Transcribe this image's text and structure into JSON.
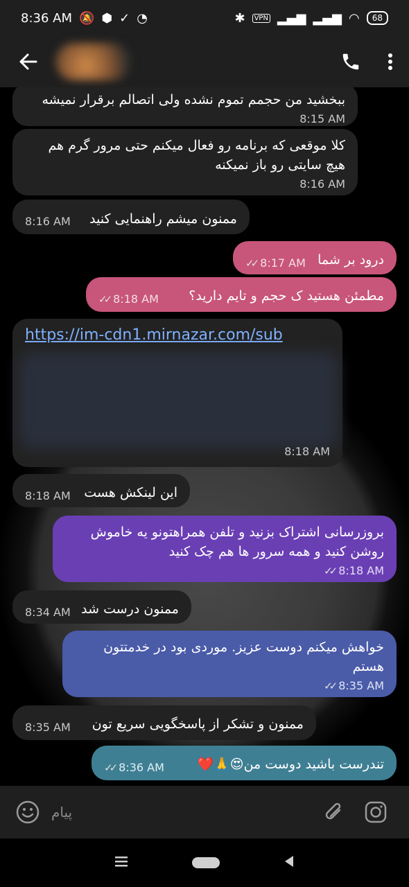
{
  "status": {
    "time": "8:36 AM",
    "vpn": "VPN",
    "battery": "68"
  },
  "toolbar": {
    "contact_name_blurred": true
  },
  "messages": [
    {
      "text": "ببخشید من حجمم تموم نشده ولی اتصالم برقرار نمیشه",
      "time": "8:15 AM"
    },
    {
      "text": "کلا موقعی که برنامه رو فعال میکنم حتی مرور گرم هم هیچ سایتی رو باز نمیکنه",
      "time": "8:16 AM"
    },
    {
      "text": "ممنون میشم راهنمایی کنید",
      "time": "8:16 AM"
    },
    {
      "text": "درود بر شما",
      "time": "8:17 AM"
    },
    {
      "text": "مطمئن هستید ک حجم و تایم دارید؟",
      "time": "8:18 AM"
    },
    {
      "link": "https://im-cdn1.mirnazar.com/sub",
      "time": "8:18 AM"
    },
    {
      "text": "این لینکش هست",
      "time": "8:18 AM"
    },
    {
      "text": "بروزرسانی اشتراک بزنید و تلفن همراهتونو یه خاموش روشن کنید و همه سرور ها هم چک کنید",
      "time": "8:18 AM"
    },
    {
      "text": "ممنون درست شد",
      "time": "8:34 AM"
    },
    {
      "text": "خواهش میکنم دوست عزیز. موردی بود در خدمتتون هستم",
      "time": "8:35 AM"
    },
    {
      "text": "ممنون و تشکر از پاسخگویی سریع تون",
      "time": "8:35 AM"
    },
    {
      "text": "تندرست باشید دوست من😍🙏❤️",
      "time": "8:36 AM"
    }
  ],
  "input": {
    "placeholder": "پیام"
  },
  "icons": {
    "back": "back-arrow-icon",
    "call": "phone-icon",
    "menu": "more-vert-icon",
    "emoji": "emoji-icon",
    "attach": "attach-icon",
    "camera": "camera-icon"
  }
}
